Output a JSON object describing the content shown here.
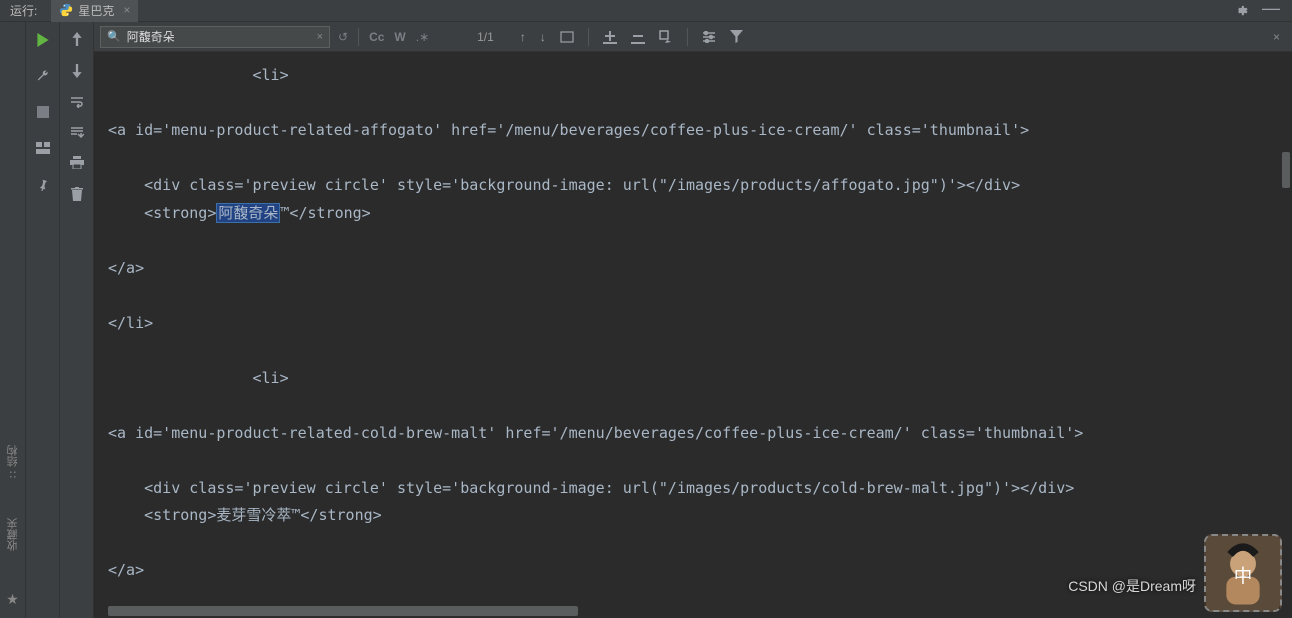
{
  "top": {
    "run_label": "运行:",
    "tab_name": "星巴克"
  },
  "find": {
    "query": "阿馥奇朵",
    "cc_label": "Cc",
    "w_label": "W",
    "count": "1/1"
  },
  "sidebar": {
    "structure": "结构",
    "favorites": "收藏夹"
  },
  "console": {
    "line1": "                <li>",
    "line2": "",
    "line3": "<a id='menu-product-related-affogato' href='/menu/beverages/coffee-plus-ice-cream/' class='thumbnail'>",
    "line4": "",
    "line5": "    <div class='preview circle' style='background-image: url(\"/images/products/affogato.jpg\")'></div>",
    "line6a": "    <strong>",
    "line6_hl": "阿馥奇朵",
    "line6b": "™</strong>",
    "line7": "",
    "line8": "</a>",
    "line9": "",
    "line10": "</li>",
    "line11": "",
    "line12": "                <li>",
    "line13": "",
    "line14": "<a id='menu-product-related-cold-brew-malt' href='/menu/beverages/coffee-plus-ice-cream/' class='thumbnail'>",
    "line15": "",
    "line16": "    <div class='preview circle' style='background-image: url(\"/images/products/cold-brew-malt.jpg\")'></div>",
    "line17": "    <strong>麦芽雪冷萃™</strong>",
    "line18": "",
    "line19": "</a>"
  },
  "watermark": {
    "text": "CSDN @是Dream呀"
  }
}
